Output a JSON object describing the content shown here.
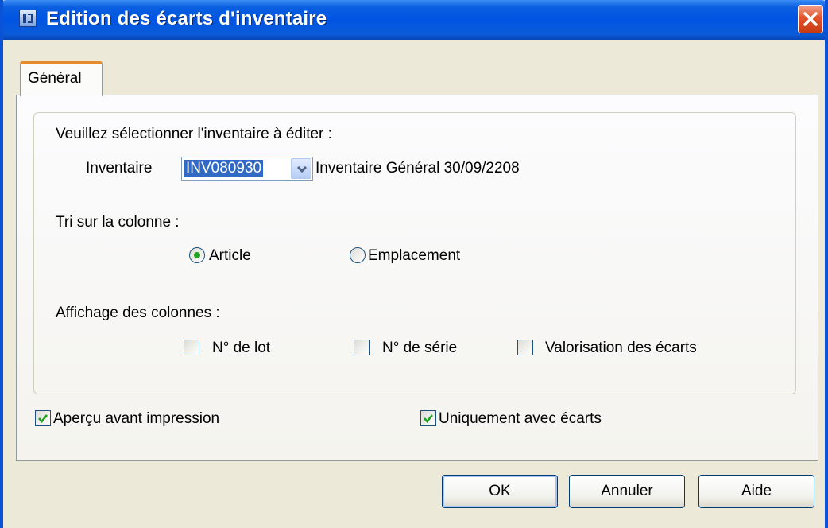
{
  "window": {
    "title": "Edition des écarts d'inventaire"
  },
  "tabs": [
    {
      "label": "Général",
      "active": true
    }
  ],
  "inventory": {
    "prompt": "Veuillez sélectionner l'inventaire à éditer :",
    "field_label": "Inventaire",
    "selected_value": "INV080930",
    "description": "Inventaire Général 30/09/2208"
  },
  "sort": {
    "label": "Tri sur la colonne :",
    "options": [
      {
        "label": "Article",
        "selected": true
      },
      {
        "label": "Emplacement",
        "selected": false
      }
    ]
  },
  "columns": {
    "label": "Affichage des colonnes :",
    "options": [
      {
        "label": "N° de lot",
        "checked": false
      },
      {
        "label": "N° de série",
        "checked": false
      },
      {
        "label": "Valorisation des écarts",
        "checked": false
      }
    ]
  },
  "options": {
    "preview": {
      "label": "Aperçu avant impression",
      "checked": true
    },
    "only_gaps": {
      "label": "Uniquement avec écarts",
      "checked": true
    }
  },
  "buttons": {
    "ok": "OK",
    "cancel": "Annuler",
    "help": "Aide"
  },
  "colors": {
    "titlebar": "#0054e3",
    "tab_highlight": "#e68b2c",
    "check": "#21a121",
    "selection": "#316ac5"
  }
}
